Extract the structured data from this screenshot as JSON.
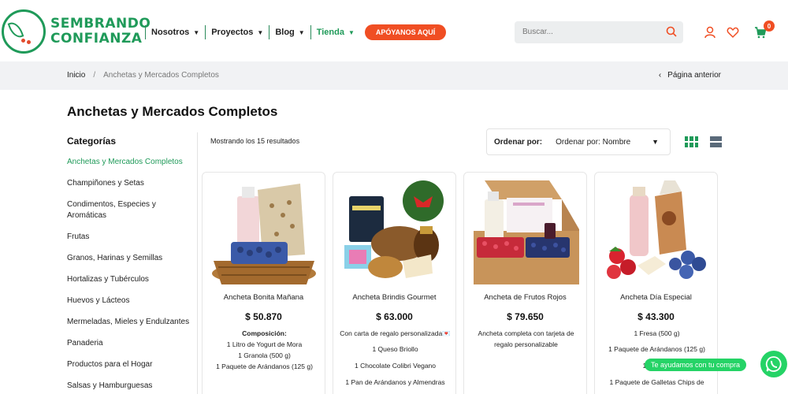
{
  "brand": {
    "line1": "SEMBRANDO",
    "line2": "CONFIANZA",
    "color": "#1f9a59",
    "accent": "#f04e23"
  },
  "nav": {
    "items": [
      {
        "label": "Nosotros",
        "active": false
      },
      {
        "label": "Proyectos",
        "active": false
      },
      {
        "label": "Blog",
        "active": false
      },
      {
        "label": "Tienda",
        "active": true
      }
    ],
    "support_label": "APÓYANOS AQUÍ"
  },
  "search": {
    "placeholder": "Buscar..."
  },
  "header_icons": [
    "user-icon",
    "heart-icon",
    "cart-icon"
  ],
  "cart": {
    "count": "0"
  },
  "breadcrumb": {
    "home": "Inicio",
    "separator": "/",
    "current": "Anchetas y Mercados Completos",
    "prev_label": "Página anterior"
  },
  "page_title": "Anchetas y Mercados Completos",
  "sidebar": {
    "title": "Categorías",
    "items": [
      {
        "label": "Anchetas y Mercados Completos",
        "active": true
      },
      {
        "label": "Champiñones y Setas"
      },
      {
        "label": "Condimentos, Especies y Aromáticas"
      },
      {
        "label": "Frutas"
      },
      {
        "label": "Granos, Harinas y Semillas"
      },
      {
        "label": "Hortalizas y Tubérculos"
      },
      {
        "label": "Huevos y Lácteos"
      },
      {
        "label": "Mermeladas, Mieles y Endulzantes"
      },
      {
        "label": "Panaderia"
      },
      {
        "label": "Productos para el Hogar"
      },
      {
        "label": "Salsas y Hamburguesas"
      }
    ]
  },
  "results": {
    "text": "Mostrando los 15 resultados"
  },
  "sort": {
    "label": "Ordenar por:",
    "value": "Ordenar por: Nombre"
  },
  "products": [
    {
      "name": "Ancheta Bonita Mañana",
      "price": "$ 50.870",
      "desc": [
        "Composición:",
        "1 Litro de Yogurt de Mora",
        "1 Granola (500 g)",
        "1 Paquete de Arándanos (125 g)"
      ]
    },
    {
      "name": "Ancheta Brindis Gourmet",
      "price": "$ 63.000",
      "desc": [
        "Con carta de regalo personalizada💌",
        "1 Queso Briollo",
        "1 Chocolate Colibri Vegano",
        "1 Pan de Arándanos y Almendras"
      ]
    },
    {
      "name": "Ancheta de Frutos Rojos",
      "price": "$ 79.650",
      "desc": [
        "Ancheta completa con tarjeta de regalo personalizable"
      ]
    },
    {
      "name": "Ancheta Día Especial",
      "price": "$ 43.300",
      "desc": [
        "1 Fresa (500 g)",
        "1 Paquete de Arándanos (125 g)",
        "1 Yogur d",
        "1 Paquete de Galletas Chips de"
      ]
    }
  ],
  "chat": {
    "label": "Te ayudamos con tu compra"
  }
}
